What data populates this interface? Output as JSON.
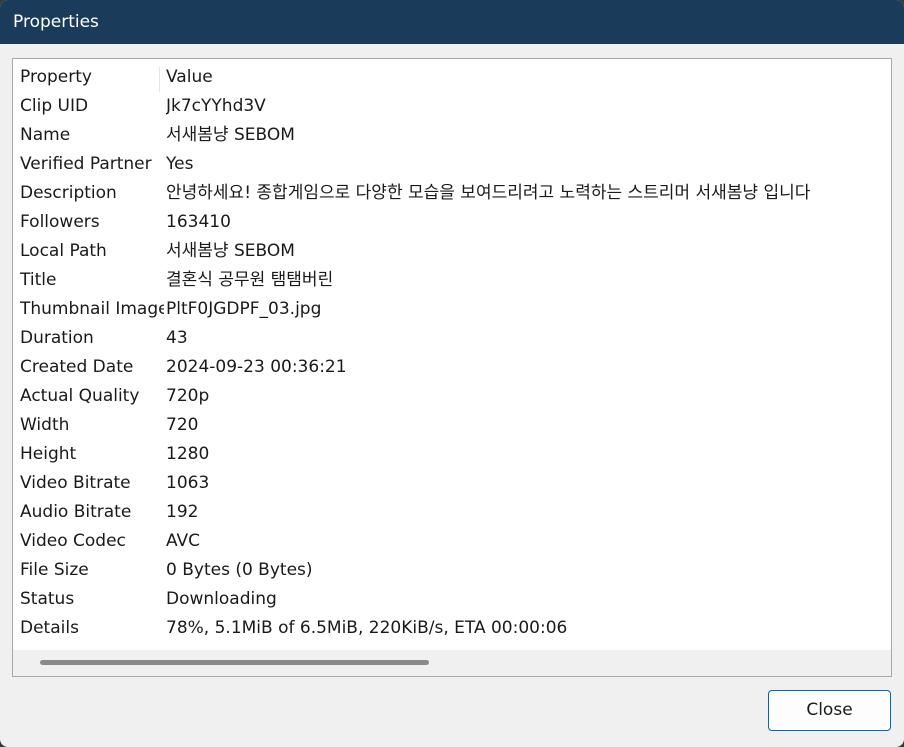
{
  "window": {
    "title": "Properties"
  },
  "table": {
    "headers": {
      "property": "Property",
      "value": "Value"
    },
    "rows": [
      {
        "property": "Clip UID",
        "value": "Jk7cYYhd3V"
      },
      {
        "property": "Name",
        "value": "서새봄냥 SEBOM"
      },
      {
        "property": "Verified Partner",
        "value": "Yes"
      },
      {
        "property": "Description",
        "value": "안녕하세요! 종합게임으로 다양한 모습을 보여드리려고 노력하는 스트리머 서새봄냥 입니다"
      },
      {
        "property": "Followers",
        "value": "163410"
      },
      {
        "property": "Local Path",
        "value": "서새봄냥 SEBOM"
      },
      {
        "property": "Title",
        "value": "결혼식 공무원 탬탬버린"
      },
      {
        "property": "Thumbnail Image",
        "value": "PltF0JGDPF_03.jpg"
      },
      {
        "property": "Duration",
        "value": "43"
      },
      {
        "property": "Created Date",
        "value": "2024-09-23 00:36:21"
      },
      {
        "property": "Actual Quality",
        "value": "720p"
      },
      {
        "property": "Width",
        "value": "720"
      },
      {
        "property": "Height",
        "value": "1280"
      },
      {
        "property": "Video Bitrate",
        "value": "1063"
      },
      {
        "property": "Audio Bitrate",
        "value": "192"
      },
      {
        "property": "Video Codec",
        "value": "AVC"
      },
      {
        "property": "File Size",
        "value": "0 Bytes (0 Bytes)"
      },
      {
        "property": "Status",
        "value": "Downloading"
      },
      {
        "property": "Details",
        "value": "78%, 5.1MiB of 6.5MiB, 220KiB/s, ETA 00:00:06"
      }
    ]
  },
  "buttons": {
    "close_label": "Close"
  },
  "colors": {
    "titlebar": "#1b3b5a",
    "accent": "#0067c0"
  }
}
